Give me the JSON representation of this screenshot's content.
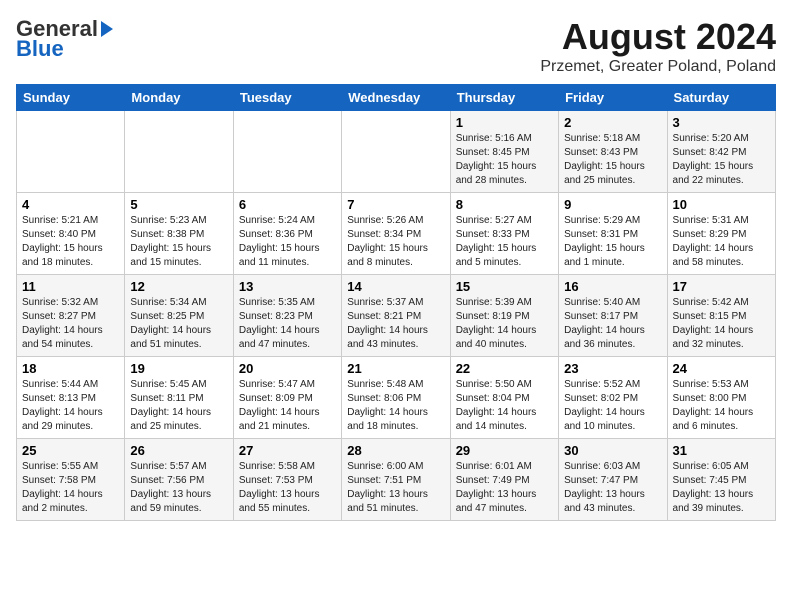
{
  "header": {
    "logo_general": "General",
    "logo_blue": "Blue",
    "month_year": "August 2024",
    "location": "Przemet, Greater Poland, Poland"
  },
  "days_of_week": [
    "Sunday",
    "Monday",
    "Tuesday",
    "Wednesday",
    "Thursday",
    "Friday",
    "Saturday"
  ],
  "weeks": [
    [
      {
        "day": "",
        "text": ""
      },
      {
        "day": "",
        "text": ""
      },
      {
        "day": "",
        "text": ""
      },
      {
        "day": "",
        "text": ""
      },
      {
        "day": "1",
        "text": "Sunrise: 5:16 AM\nSunset: 8:45 PM\nDaylight: 15 hours\nand 28 minutes."
      },
      {
        "day": "2",
        "text": "Sunrise: 5:18 AM\nSunset: 8:43 PM\nDaylight: 15 hours\nand 25 minutes."
      },
      {
        "day": "3",
        "text": "Sunrise: 5:20 AM\nSunset: 8:42 PM\nDaylight: 15 hours\nand 22 minutes."
      }
    ],
    [
      {
        "day": "4",
        "text": "Sunrise: 5:21 AM\nSunset: 8:40 PM\nDaylight: 15 hours\nand 18 minutes."
      },
      {
        "day": "5",
        "text": "Sunrise: 5:23 AM\nSunset: 8:38 PM\nDaylight: 15 hours\nand 15 minutes."
      },
      {
        "day": "6",
        "text": "Sunrise: 5:24 AM\nSunset: 8:36 PM\nDaylight: 15 hours\nand 11 minutes."
      },
      {
        "day": "7",
        "text": "Sunrise: 5:26 AM\nSunset: 8:34 PM\nDaylight: 15 hours\nand 8 minutes."
      },
      {
        "day": "8",
        "text": "Sunrise: 5:27 AM\nSunset: 8:33 PM\nDaylight: 15 hours\nand 5 minutes."
      },
      {
        "day": "9",
        "text": "Sunrise: 5:29 AM\nSunset: 8:31 PM\nDaylight: 15 hours\nand 1 minute."
      },
      {
        "day": "10",
        "text": "Sunrise: 5:31 AM\nSunset: 8:29 PM\nDaylight: 14 hours\nand 58 minutes."
      }
    ],
    [
      {
        "day": "11",
        "text": "Sunrise: 5:32 AM\nSunset: 8:27 PM\nDaylight: 14 hours\nand 54 minutes."
      },
      {
        "day": "12",
        "text": "Sunrise: 5:34 AM\nSunset: 8:25 PM\nDaylight: 14 hours\nand 51 minutes."
      },
      {
        "day": "13",
        "text": "Sunrise: 5:35 AM\nSunset: 8:23 PM\nDaylight: 14 hours\nand 47 minutes."
      },
      {
        "day": "14",
        "text": "Sunrise: 5:37 AM\nSunset: 8:21 PM\nDaylight: 14 hours\nand 43 minutes."
      },
      {
        "day": "15",
        "text": "Sunrise: 5:39 AM\nSunset: 8:19 PM\nDaylight: 14 hours\nand 40 minutes."
      },
      {
        "day": "16",
        "text": "Sunrise: 5:40 AM\nSunset: 8:17 PM\nDaylight: 14 hours\nand 36 minutes."
      },
      {
        "day": "17",
        "text": "Sunrise: 5:42 AM\nSunset: 8:15 PM\nDaylight: 14 hours\nand 32 minutes."
      }
    ],
    [
      {
        "day": "18",
        "text": "Sunrise: 5:44 AM\nSunset: 8:13 PM\nDaylight: 14 hours\nand 29 minutes."
      },
      {
        "day": "19",
        "text": "Sunrise: 5:45 AM\nSunset: 8:11 PM\nDaylight: 14 hours\nand 25 minutes."
      },
      {
        "day": "20",
        "text": "Sunrise: 5:47 AM\nSunset: 8:09 PM\nDaylight: 14 hours\nand 21 minutes."
      },
      {
        "day": "21",
        "text": "Sunrise: 5:48 AM\nSunset: 8:06 PM\nDaylight: 14 hours\nand 18 minutes."
      },
      {
        "day": "22",
        "text": "Sunrise: 5:50 AM\nSunset: 8:04 PM\nDaylight: 14 hours\nand 14 minutes."
      },
      {
        "day": "23",
        "text": "Sunrise: 5:52 AM\nSunset: 8:02 PM\nDaylight: 14 hours\nand 10 minutes."
      },
      {
        "day": "24",
        "text": "Sunrise: 5:53 AM\nSunset: 8:00 PM\nDaylight: 14 hours\nand 6 minutes."
      }
    ],
    [
      {
        "day": "25",
        "text": "Sunrise: 5:55 AM\nSunset: 7:58 PM\nDaylight: 14 hours\nand 2 minutes."
      },
      {
        "day": "26",
        "text": "Sunrise: 5:57 AM\nSunset: 7:56 PM\nDaylight: 13 hours\nand 59 minutes."
      },
      {
        "day": "27",
        "text": "Sunrise: 5:58 AM\nSunset: 7:53 PM\nDaylight: 13 hours\nand 55 minutes."
      },
      {
        "day": "28",
        "text": "Sunrise: 6:00 AM\nSunset: 7:51 PM\nDaylight: 13 hours\nand 51 minutes."
      },
      {
        "day": "29",
        "text": "Sunrise: 6:01 AM\nSunset: 7:49 PM\nDaylight: 13 hours\nand 47 minutes."
      },
      {
        "day": "30",
        "text": "Sunrise: 6:03 AM\nSunset: 7:47 PM\nDaylight: 13 hours\nand 43 minutes."
      },
      {
        "day": "31",
        "text": "Sunrise: 6:05 AM\nSunset: 7:45 PM\nDaylight: 13 hours\nand 39 minutes."
      }
    ]
  ]
}
